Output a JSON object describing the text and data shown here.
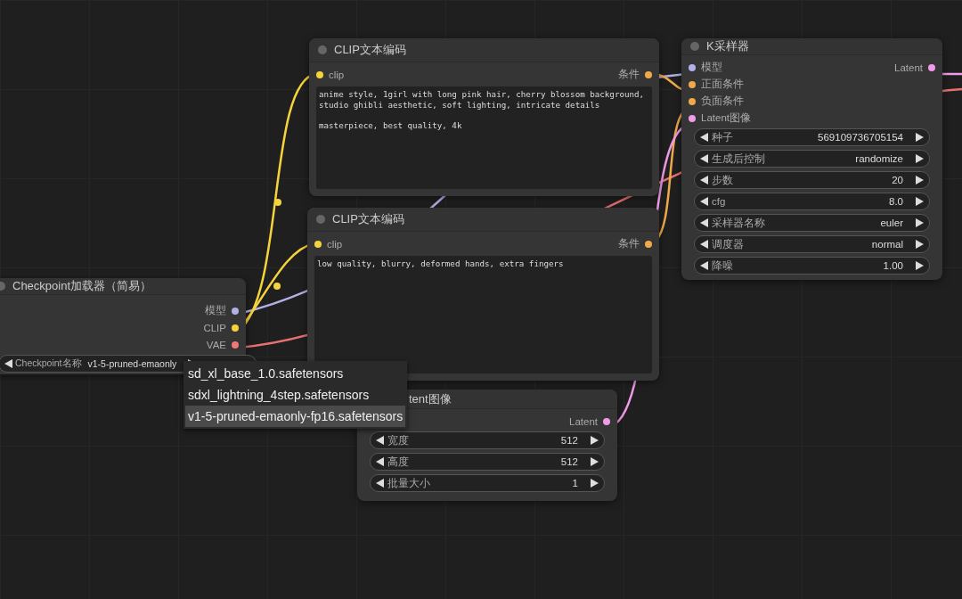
{
  "nodes": [
    {
      "title": "CLIP文本编码",
      "inputs": [
        {
          "label": "clip",
          "color": "#f5d33a"
        }
      ],
      "outputs": [
        {
          "label": "条件",
          "color": "#f0a94a"
        }
      ],
      "text": "anime style, 1girl with long pink hair, cherry blossom background,\nstudio ghibli aesthetic, soft lighting, intricate details\n\nmasterpiece, best quality, 4k"
    },
    {
      "title": "CLIP文本编码",
      "inputs": [
        {
          "label": "clip",
          "color": "#f5d33a"
        }
      ],
      "outputs": [
        {
          "label": "条件",
          "color": "#f0a94a"
        }
      ],
      "text": "low quality, blurry, deformed hands, extra fingers"
    },
    {
      "title": "K采样器",
      "inputs": [
        {
          "label": "模型",
          "color": "#b3b0e8"
        },
        {
          "label": "正面条件",
          "color": "#f0a94a"
        },
        {
          "label": "负面条件",
          "color": "#f0a94a"
        },
        {
          "label": "Latent图像",
          "color": "#f09be8"
        }
      ],
      "outputs": [
        {
          "label": "Latent",
          "color": "#f09be8"
        }
      ],
      "widgets": [
        {
          "label": "种子",
          "value": "569109736705154"
        },
        {
          "label": "生成后控制",
          "value": "randomize"
        },
        {
          "label": "步数",
          "value": "20"
        },
        {
          "label": "cfg",
          "value": "8.0"
        },
        {
          "label": "采样器名称",
          "value": "euler"
        },
        {
          "label": "调度器",
          "value": "normal"
        },
        {
          "label": "降噪",
          "value": "1.00"
        }
      ]
    },
    {
      "title": "Checkpoint加载器（简易）",
      "outputs": [
        {
          "label": "模型",
          "color": "#b3b0e8"
        },
        {
          "label": "CLIP",
          "color": "#f5d33a"
        },
        {
          "label": "VAE",
          "color": "#f07878"
        }
      ],
      "widgets": [
        {
          "label": "Checkpoint名称",
          "value": "v1-5-pruned-emaonly"
        }
      ]
    },
    {
      "title": "tent图像",
      "outputs": [
        {
          "label": "Latent",
          "color": "#f09be8"
        }
      ],
      "widgets": [
        {
          "label": "宽度",
          "value": "512"
        },
        {
          "label": "高度",
          "value": "512"
        },
        {
          "label": "批量大小",
          "value": "1"
        }
      ]
    }
  ],
  "dropdown": {
    "items": [
      {
        "label": "sd_xl_base_1.0.safetensors",
        "selected": false
      },
      {
        "label": "sdxl_lightning_4step.safetensors",
        "selected": false
      },
      {
        "label": "v1-5-pruned-emaonly-fp16.safetensors",
        "selected": true
      }
    ]
  }
}
